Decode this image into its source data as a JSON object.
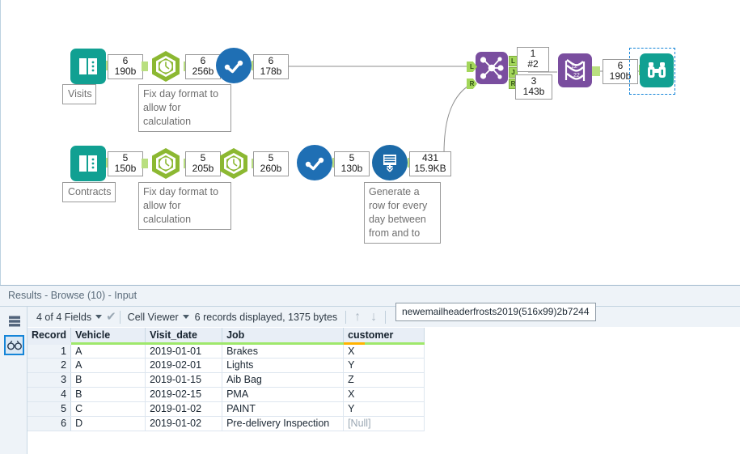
{
  "canvas": {
    "tools": [
      {
        "id": "visits-input",
        "icon": "book-input-icon",
        "name": "Input Data",
        "annotation": "Visits"
      },
      {
        "id": "visits-datetime",
        "icon": "clock-hexagon-icon",
        "name": "DateTime",
        "annotation": "Fix day format to\nallow for\ncalculation"
      },
      {
        "id": "visits-select",
        "icon": "select-circle-icon",
        "name": "Select"
      },
      {
        "id": "contracts-input",
        "icon": "book-input-icon",
        "name": "Input Data",
        "annotation": "Contracts"
      },
      {
        "id": "contracts-datetime-1",
        "icon": "clock-hexagon-icon",
        "name": "DateTime",
        "annotation": "Fix day format to\nallow for\ncalculation"
      },
      {
        "id": "contracts-datetime-2",
        "icon": "clock-hexagon-icon",
        "name": "DateTime"
      },
      {
        "id": "contracts-select",
        "icon": "select-circle-icon",
        "name": "Select"
      },
      {
        "id": "generate-rows",
        "icon": "generate-rows-icon",
        "name": "Generate Rows",
        "annotation": "Generate a row\nfor every day\nbetween from\nand to"
      },
      {
        "id": "join",
        "icon": "join-icon",
        "name": "Join"
      },
      {
        "id": "transpose",
        "icon": "transpose-icon",
        "name": "Transpose"
      },
      {
        "id": "browse",
        "icon": "binoculars-icon",
        "name": "Browse",
        "selected": true
      }
    ],
    "data_labels": [
      {
        "id": "lbl-visits-in",
        "count": "6",
        "size": "190b"
      },
      {
        "id": "lbl-visits-dt",
        "count": "6",
        "size": "256b"
      },
      {
        "id": "lbl-visits-sel",
        "count": "6",
        "size": "178b"
      },
      {
        "id": "lbl-contracts-in",
        "count": "5",
        "size": "150b"
      },
      {
        "id": "lbl-contracts-dt1",
        "count": "5",
        "size": "205b"
      },
      {
        "id": "lbl-contracts-dt2",
        "count": "5",
        "size": "260b"
      },
      {
        "id": "lbl-contracts-sel",
        "count": "5",
        "size": "130b"
      },
      {
        "id": "lbl-genrows",
        "count": "431",
        "size": "15.9KB"
      },
      {
        "id": "lbl-join-top",
        "count": "1",
        "size": "#2"
      },
      {
        "id": "lbl-join-bottom",
        "count": "3",
        "size": "143b"
      },
      {
        "id": "lbl-browse-in",
        "count": "6",
        "size": "190b"
      }
    ],
    "annotations": {
      "visits": "Visits",
      "contracts": "Contracts",
      "fix_day_1": "Fix day format to allow for calculation",
      "fix_day_2": "Fix day format to allow for calculation",
      "generate_rows": "Generate a row for every day between from and to"
    },
    "anchors": {
      "join_in_left": "L",
      "join_in_right": "R",
      "join_out_left": "L",
      "join_out_join": "J",
      "join_out_right": "R"
    }
  },
  "results": {
    "title_prefix": "Results",
    "title": "Results - Browse (10) - Input",
    "tooltip": "newemailheaderfrosts2019(516x99)2b7244",
    "toolbar": {
      "fields_label": "4 of 4 Fields",
      "cell_viewer_label": "Cell Viewer",
      "records_label": "6 records displayed, 1375 bytes",
      "up_arrow": "↑",
      "down_arrow": "↓",
      "checkmark": "✔"
    },
    "rail": {
      "grid_icon": "table-grid-icon",
      "browse_icon": "binoculars-icon"
    },
    "grid": {
      "columns": [
        "Record",
        "Vehicle",
        "Visit_date",
        "Job",
        "customer"
      ],
      "rows": [
        {
          "record": "1",
          "vehicle": "A",
          "visit_date": "2019-01-01",
          "job": "Brakes",
          "customer": "X"
        },
        {
          "record": "2",
          "vehicle": "A",
          "visit_date": "2019-02-01",
          "job": "Lights",
          "customer": "Y"
        },
        {
          "record": "3",
          "vehicle": "B",
          "visit_date": "2019-01-15",
          "job": "Aib Bag",
          "customer": "Z"
        },
        {
          "record": "4",
          "vehicle": "B",
          "visit_date": "2019-02-15",
          "job": "PMA",
          "customer": "X"
        },
        {
          "record": "5",
          "vehicle": "C",
          "visit_date": "2019-01-02",
          "job": "PAINT",
          "customer": "Y"
        },
        {
          "record": "6",
          "vehicle": "D",
          "visit_date": "2019-01-02",
          "job": "Pre-delivery Inspection",
          "customer": "[Null]"
        }
      ]
    }
  },
  "colors": {
    "teal": "#11a092",
    "purple": "#7a4e9f",
    "blue": "#1f6fb4",
    "green_hex": "#8cb832",
    "anchor_green": "#a3d65a",
    "select_blue": "#1585d8",
    "header_green": "#9fe86b",
    "header_orange": "#ffb300"
  }
}
